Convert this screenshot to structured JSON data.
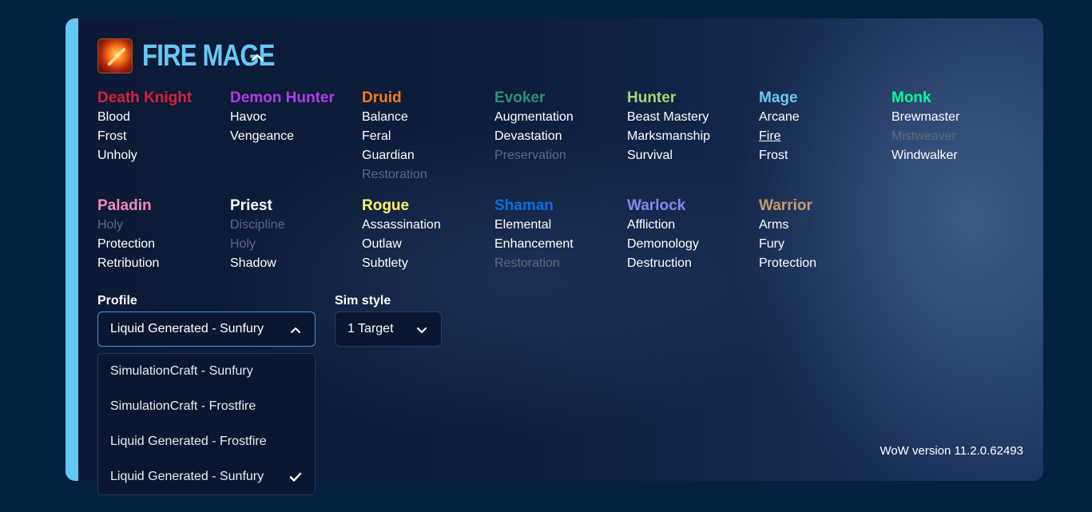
{
  "header": {
    "title": "FIRE MAGE",
    "icon": "fire-mage-spec-icon"
  },
  "colors": {
    "accent": "#63c6f0",
    "death_knight": "#d9213a",
    "demon_hunter": "#b13be8",
    "druid": "#ff7d0a",
    "evoker": "#2e8f79",
    "hunter": "#a9d66b",
    "mage": "#6cc8f5",
    "monk": "#00ff96",
    "paladin": "#f48cba",
    "priest": "#ffffff",
    "rogue": "#fff468",
    "shaman": "#0a70de",
    "warlock": "#8788ee",
    "warrior": "#c69b6d",
    "disabled_spec": "#5d6a82"
  },
  "classes": [
    {
      "name": "Death Knight",
      "color": "#d9213a",
      "specs": [
        {
          "label": "Blood",
          "state": "enabled"
        },
        {
          "label": "Frost",
          "state": "enabled"
        },
        {
          "label": "Unholy",
          "state": "enabled"
        }
      ]
    },
    {
      "name": "Demon Hunter",
      "color": "#b13be8",
      "specs": [
        {
          "label": "Havoc",
          "state": "enabled"
        },
        {
          "label": "Vengeance",
          "state": "enabled"
        }
      ]
    },
    {
      "name": "Druid",
      "color": "#ff7d0a",
      "specs": [
        {
          "label": "Balance",
          "state": "enabled"
        },
        {
          "label": "Feral",
          "state": "enabled"
        },
        {
          "label": "Guardian",
          "state": "enabled"
        },
        {
          "label": "Restoration",
          "state": "disabled"
        }
      ]
    },
    {
      "name": "Evoker",
      "color": "#2e8f79",
      "specs": [
        {
          "label": "Augmentation",
          "state": "enabled"
        },
        {
          "label": "Devastation",
          "state": "enabled"
        },
        {
          "label": "Preservation",
          "state": "disabled"
        }
      ]
    },
    {
      "name": "Hunter",
      "color": "#a9d66b",
      "specs": [
        {
          "label": "Beast Mastery",
          "state": "enabled"
        },
        {
          "label": "Marksmanship",
          "state": "enabled"
        },
        {
          "label": "Survival",
          "state": "enabled"
        }
      ]
    },
    {
      "name": "Mage",
      "color": "#6cc8f5",
      "specs": [
        {
          "label": "Arcane",
          "state": "enabled"
        },
        {
          "label": "Fire",
          "state": "active"
        },
        {
          "label": "Frost",
          "state": "enabled"
        }
      ]
    },
    {
      "name": "Monk",
      "color": "#00ff96",
      "specs": [
        {
          "label": "Brewmaster",
          "state": "enabled"
        },
        {
          "label": "Mistweaver",
          "state": "disabled"
        },
        {
          "label": "Windwalker",
          "state": "enabled"
        }
      ]
    },
    {
      "name": "Paladin",
      "color": "#f48cba",
      "specs": [
        {
          "label": "Holy",
          "state": "disabled"
        },
        {
          "label": "Protection",
          "state": "enabled"
        },
        {
          "label": "Retribution",
          "state": "enabled"
        }
      ]
    },
    {
      "name": "Priest",
      "color": "#ffffff",
      "specs": [
        {
          "label": "Discipline",
          "state": "disabled"
        },
        {
          "label": "Holy",
          "state": "disabled"
        },
        {
          "label": "Shadow",
          "state": "enabled"
        }
      ]
    },
    {
      "name": "Rogue",
      "color": "#fff468",
      "specs": [
        {
          "label": "Assassination",
          "state": "enabled"
        },
        {
          "label": "Outlaw",
          "state": "enabled"
        },
        {
          "label": "Subtlety",
          "state": "enabled"
        }
      ]
    },
    {
      "name": "Shaman",
      "color": "#0a70de",
      "specs": [
        {
          "label": "Elemental",
          "state": "enabled"
        },
        {
          "label": "Enhancement",
          "state": "enabled"
        },
        {
          "label": "Restoration",
          "state": "disabled"
        }
      ]
    },
    {
      "name": "Warlock",
      "color": "#8788ee",
      "specs": [
        {
          "label": "Affliction",
          "state": "enabled"
        },
        {
          "label": "Demonology",
          "state": "enabled"
        },
        {
          "label": "Destruction",
          "state": "enabled"
        }
      ]
    },
    {
      "name": "Warrior",
      "color": "#c69b6d",
      "specs": [
        {
          "label": "Arms",
          "state": "enabled"
        },
        {
          "label": "Fury",
          "state": "enabled"
        },
        {
          "label": "Protection",
          "state": "enabled"
        }
      ]
    }
  ],
  "profile": {
    "label": "Profile",
    "selected": "Liquid Generated - Sunfury",
    "options": [
      "SimulationCraft - Sunfury",
      "SimulationCraft - Frostfire",
      "Liquid Generated - Frostfire",
      "Liquid Generated - Sunfury"
    ],
    "checked_option": "Liquid Generated - Sunfury"
  },
  "sim_style": {
    "label": "Sim style",
    "selected": "1 Target"
  },
  "footer": {
    "version": "WoW version 11.2.0.62493"
  }
}
